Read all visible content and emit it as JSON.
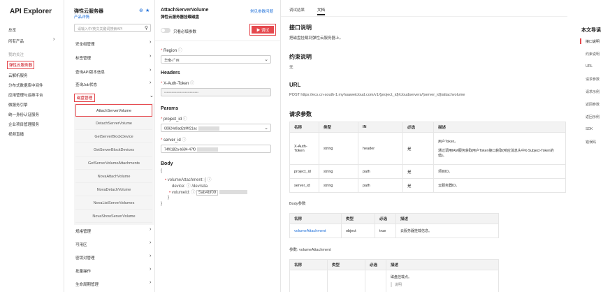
{
  "app": {
    "title": "API Explorer"
  },
  "left_nav": {
    "items": [
      {
        "label": "总览"
      },
      {
        "label": "所有产品"
      },
      {
        "label": "我的关注"
      },
      {
        "label": "弹性云服务器"
      },
      {
        "label": "云解析服务"
      },
      {
        "label": "分布式数据库中间件"
      },
      {
        "label": "应用管理与运维平台"
      },
      {
        "label": "微服务引擎"
      },
      {
        "label": "统一身份认证服务"
      },
      {
        "label": "企业项目管理服务"
      },
      {
        "label": "视频直播"
      }
    ]
  },
  "service": {
    "title": "弹性云服务器",
    "subtitle": "产品详情",
    "search_placeholder": "请输入中/英文关键词搜索API",
    "categories": [
      {
        "label": "安全组管理"
      },
      {
        "label": "标签管理"
      },
      {
        "label": "查询API版本信息"
      },
      {
        "label": "查询Job状态"
      },
      {
        "label": "磁盘管理"
      }
    ],
    "apis": [
      {
        "label": "AttachServerVolume"
      },
      {
        "label": "DetachServerVolume"
      },
      {
        "label": "GetServerBlockDevice"
      },
      {
        "label": "GetServerBlockDevices"
      },
      {
        "label": "GetServerVolumeAttachments"
      },
      {
        "label": "NovaAttachVolume"
      },
      {
        "label": "NovaDetachVolume"
      },
      {
        "label": "NovaListServerVolumes"
      },
      {
        "label": "NovaShowServerVolume"
      }
    ],
    "categories_after": [
      {
        "label": "规格管理"
      },
      {
        "label": "可用区"
      },
      {
        "label": "密钥对管理"
      },
      {
        "label": "批量操作"
      },
      {
        "label": "生命周期管理"
      }
    ]
  },
  "debug": {
    "api_name": "AttachServerVolume",
    "api_desc": "弹性云服务器挂载磁盘",
    "faq_link": "常见参数问题",
    "only_required": "只看必填参数",
    "debug_button": "▶ 调试",
    "region_label": "Region",
    "region_value": "华南-广州",
    "headers_title": "Headers",
    "auth_label": "X-Auth-Token",
    "auth_placeholder": "••••••••••••••••••••••••••••",
    "params_title": "Params",
    "project_label": "project_id",
    "project_value": "00924d0ad2df4f21ac",
    "server_label": "server_id",
    "server_value": "74f0182a-b684-47f0",
    "body_title": "Body",
    "body_open": "{",
    "body_key": "volumeAttachment: {",
    "device_label": "device:",
    "device_value": "/dev/sda",
    "volume_label": "volumeId:",
    "volume_value": "5ab4bf09",
    "body_inner_close": "}",
    "body_close": "}"
  },
  "doc": {
    "tabs": [
      {
        "label": "调试结果"
      },
      {
        "label": "文档"
      }
    ],
    "intro_title": "接口说明",
    "intro_text": "把磁盘挂载到弹性云服务器上。",
    "constraint_title": "约束说明",
    "constraint_text": "无",
    "url_title": "URL",
    "url_text": "POST  https://ecs.cn-south-1.myhuaweicloud.com/v1/{project_id}/cloudservers/{server_id}/attachvolume",
    "req_title": "请求参数",
    "req_table": {
      "headers": [
        "名称",
        "类型",
        "IN",
        "必选",
        "描述"
      ],
      "rows": [
        [
          "X-Auth-Token",
          "string",
          "header",
          "是",
          "用户Token。"
        ],
        [
          "project_id",
          "string",
          "path",
          "是",
          "项目ID。"
        ],
        [
          "server_id",
          "string",
          "path",
          "是",
          "云服务器ID。"
        ]
      ],
      "auth_desc2": "通过调用IAM服务获取用户Token接口获取(响应消息头中X-Subject-Token的值)。"
    },
    "body_title": "Body参数",
    "body_table": {
      "headers": [
        "名称",
        "类型",
        "必选",
        "描述"
      ],
      "rows": [
        [
          "volumeAttachment",
          "object",
          "true",
          "云服务器挂载信息。"
        ]
      ]
    },
    "va_title": "参数: volumeAttachment",
    "va_table": {
      "headers": [
        "名称",
        "类型",
        "必选",
        "描述"
      ],
      "desc1": "磁盘挂载点。",
      "desc2": "说明"
    }
  },
  "toc": {
    "title": "本文导读",
    "items": [
      {
        "label": "接口说明"
      },
      {
        "label": "约束说明"
      },
      {
        "label": "URL"
      },
      {
        "label": "请求参数"
      },
      {
        "label": "请求示例"
      },
      {
        "label": "返回参数"
      },
      {
        "label": "返回示例"
      },
      {
        "label": "SDK"
      },
      {
        "label": "错误码"
      }
    ]
  }
}
